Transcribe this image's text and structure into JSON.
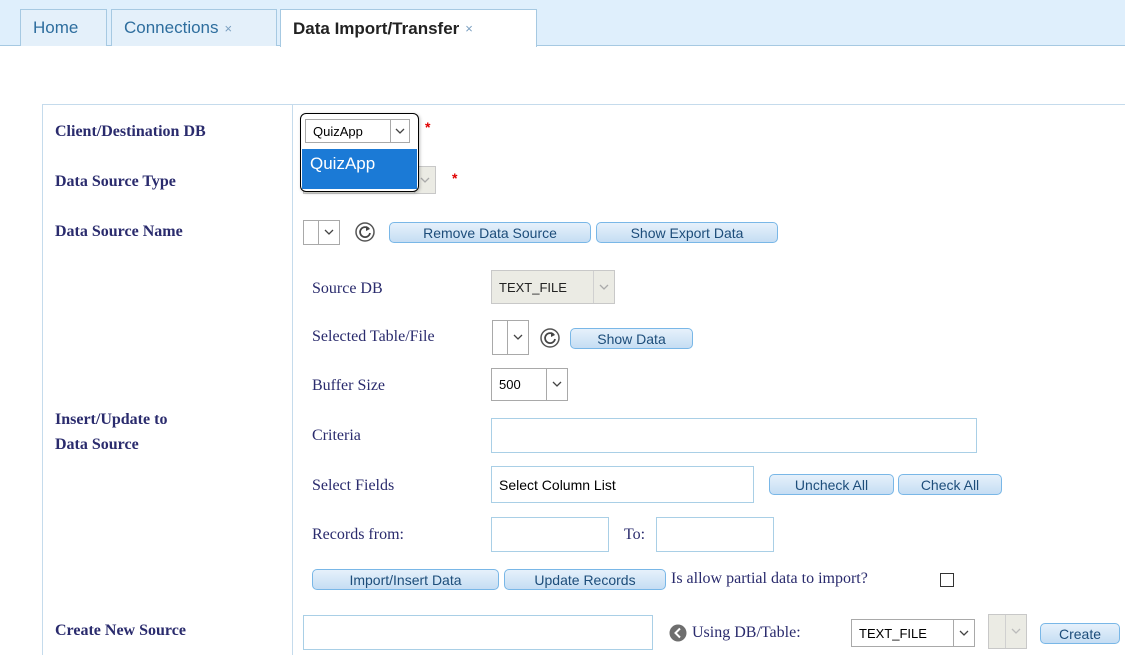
{
  "tabs": [
    {
      "label": "Home",
      "closable": false,
      "active": false
    },
    {
      "label": "Connections",
      "closable": true,
      "active": false
    },
    {
      "label": "Data Import/Transfer",
      "closable": true,
      "active": true
    }
  ],
  "close_glyph": "×",
  "required_mark": "*",
  "left_labels": {
    "client_db": "Client/Destination DB",
    "source_type": "Data Source Type",
    "source_name": "Data Source Name",
    "insert_update_1": "Insert/Update to",
    "insert_update_2": "Data Source",
    "create_new": "Create New Source"
  },
  "client_db": {
    "value": "QuizApp",
    "options": [
      "QuizApp"
    ],
    "highlighted_option": "QuizApp"
  },
  "source_name_buttons": {
    "remove": "Remove Data Source",
    "show_export": "Show Export Data"
  },
  "detail": {
    "source_db_label": "Source DB",
    "source_db_value": "TEXT_FILE",
    "selected_table_label": "Selected Table/File",
    "show_data_button": "Show Data",
    "buffer_size_label": "Buffer Size",
    "buffer_size_value": "500",
    "criteria_label": "Criteria",
    "criteria_value": "",
    "select_fields_label": "Select Fields",
    "select_fields_value": "Select Column List",
    "uncheck_all": "Uncheck All",
    "check_all": "Check All",
    "records_from_label": "Records from:",
    "to_label": "To:",
    "records_from_value": "",
    "records_to_value": "",
    "import_insert_button": "Import/Insert Data",
    "update_records_button": "Update Records",
    "partial_label": "Is allow partial data to import?",
    "partial_checked": false
  },
  "create": {
    "name_value": "",
    "using_label": "Using DB/Table:",
    "using_value": "TEXT_FILE",
    "create_button": "Create"
  },
  "colors": {
    "label": "#2a2b6d",
    "tabbar": "#dfeffc",
    "highlight": "#1b7ad6",
    "required": "#e00000"
  },
  "icons": {
    "refresh": "refresh-icon",
    "caret": "chevron-down-icon",
    "back": "circle-arrow-left-icon"
  }
}
